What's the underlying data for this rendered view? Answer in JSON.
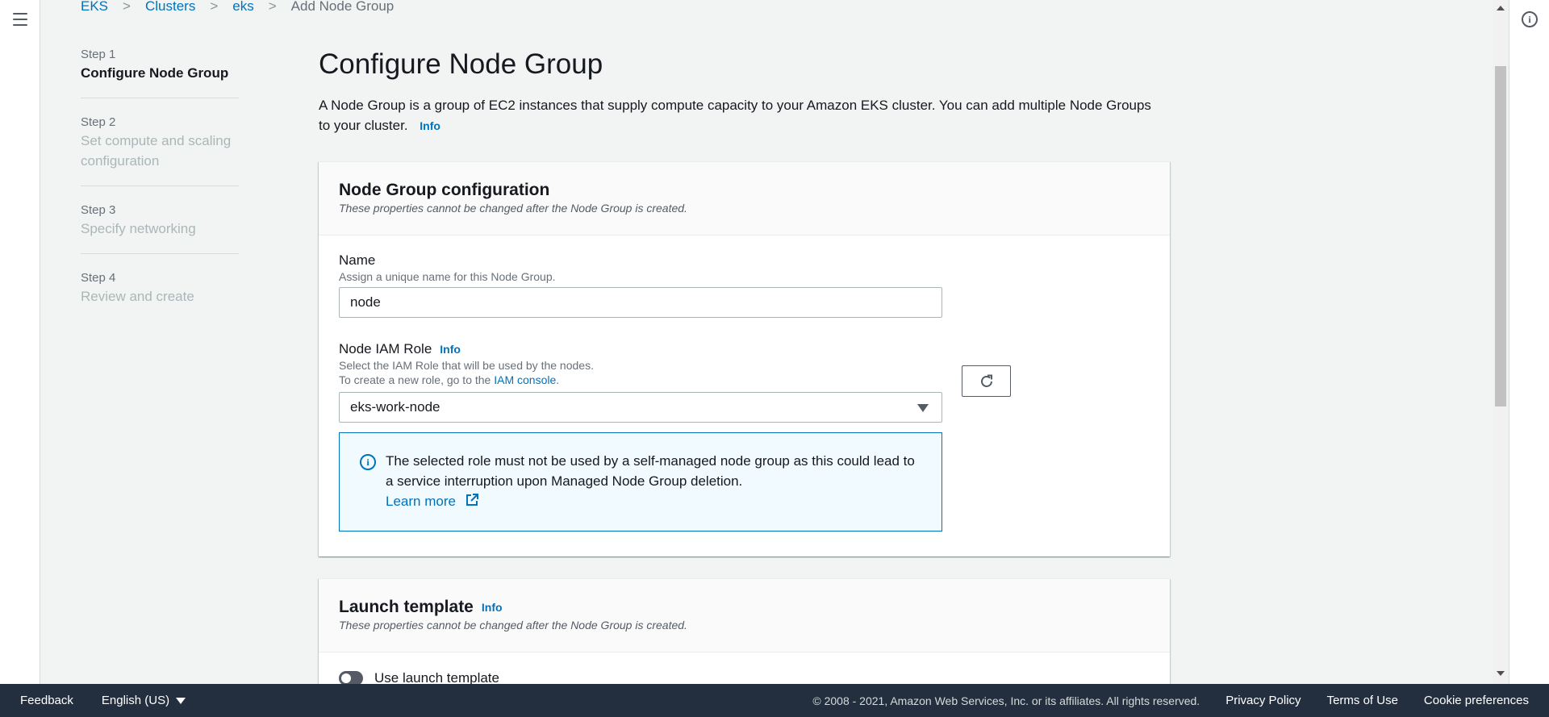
{
  "breadcrumb": {
    "items": [
      "EKS",
      "Clusters",
      "eks"
    ],
    "current": "Add Node Group"
  },
  "steps": [
    {
      "number": "Step 1",
      "title": "Configure Node Group",
      "active": true
    },
    {
      "number": "Step 2",
      "title": "Set compute and scaling configuration",
      "active": false
    },
    {
      "number": "Step 3",
      "title": "Specify networking",
      "active": false
    },
    {
      "number": "Step 4",
      "title": "Review and create",
      "active": false
    }
  ],
  "main": {
    "title": "Configure Node Group",
    "description": "A Node Group is a group of EC2 instances that supply compute capacity to your Amazon EKS cluster. You can add multiple Node Groups to your cluster.",
    "info_link": "Info"
  },
  "node_group_config": {
    "header": "Node Group configuration",
    "subheader": "These properties cannot be changed after the Node Group is created.",
    "name": {
      "label": "Name",
      "description": "Assign a unique name for this Node Group.",
      "value": "node"
    },
    "iam_role": {
      "label": "Node IAM Role",
      "info_link": "Info",
      "description_1": "Select the IAM Role that will be used by the nodes.",
      "description_2_prefix": "To create a new role, go to the",
      "description_2_link": "IAM console",
      "description_2_suffix": ".",
      "selected": "eks-work-node"
    },
    "alert": {
      "text": "The selected role must not be used by a self-managed node group as this could lead to a service interruption upon Managed Node Group deletion.",
      "link": "Learn more"
    }
  },
  "launch_template": {
    "header": "Launch template",
    "info_link": "Info",
    "subheader": "These properties cannot be changed after the Node Group is created.",
    "toggle_label": "Use launch template",
    "toggle_on": false
  },
  "footer": {
    "feedback": "Feedback",
    "language": "English (US)",
    "copyright": "© 2008 - 2021, Amazon Web Services, Inc. or its affiliates. All rights reserved.",
    "links": [
      "Privacy Policy",
      "Terms of Use",
      "Cookie preferences"
    ]
  },
  "colors": {
    "link": "#0073bb",
    "footer_bg": "#232f3e",
    "page_bg": "#f2f3f3"
  },
  "icons": [
    "menu-icon",
    "info-circle-icon",
    "chevron-right-icon",
    "caret-down-icon",
    "refresh-icon",
    "external-link-icon",
    "toggle-icon"
  ]
}
